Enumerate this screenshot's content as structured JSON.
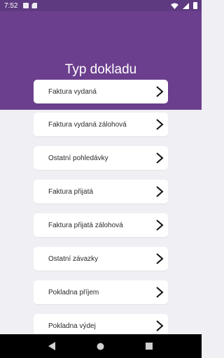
{
  "status_bar": {
    "time": "7:52",
    "icons": [
      "notification-a-icon",
      "sd-card-icon",
      "wifi-icon",
      "signal-icon",
      "battery-icon"
    ]
  },
  "header": {
    "title": "Typ dokladu",
    "background": "#6c3f8e"
  },
  "document_types": [
    {
      "label": "Faktura vydaná"
    },
    {
      "label": "Faktura vydaná zálohová"
    },
    {
      "label": "Ostatní pohledávky"
    },
    {
      "label": "Faktura přijatá"
    },
    {
      "label": "Faktura přijatá zálohová"
    },
    {
      "label": "Ostatní závazky"
    },
    {
      "label": "Pokladna příjem"
    },
    {
      "label": "Pokladna výdej"
    }
  ],
  "navigation_bar": {
    "icons": [
      "back-icon",
      "home-icon",
      "recents-icon"
    ]
  }
}
